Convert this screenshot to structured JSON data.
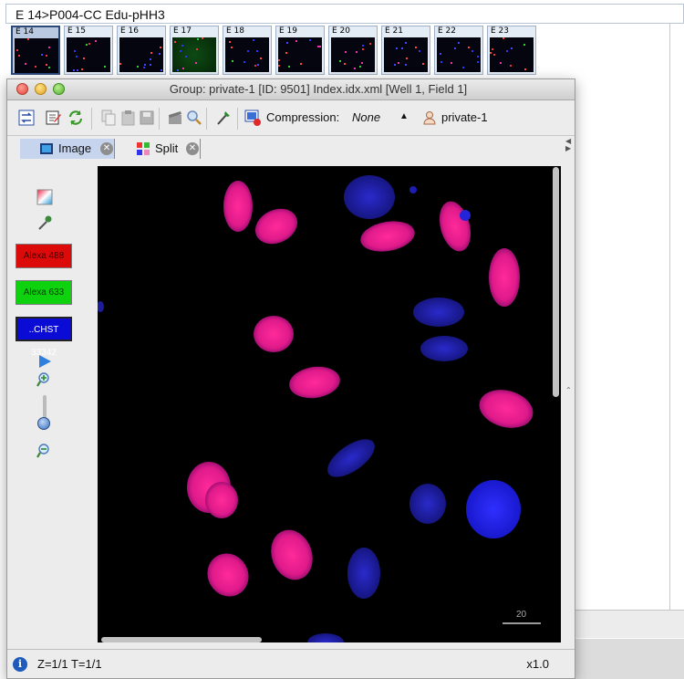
{
  "background_window": {
    "title": "E 14>P004-CC Edu-pHH3",
    "thumbnails": [
      {
        "label": "E 14",
        "selected": true
      },
      {
        "label": "E 15",
        "selected": false
      },
      {
        "label": "E 16",
        "selected": false
      },
      {
        "label": "E 17",
        "selected": false
      },
      {
        "label": "E 18",
        "selected": false
      },
      {
        "label": "E 19",
        "selected": false
      },
      {
        "label": "E 20",
        "selected": false
      },
      {
        "label": "E 21",
        "selected": false
      },
      {
        "label": "E 22",
        "selected": false
      },
      {
        "label": "E 23",
        "selected": false
      }
    ]
  },
  "window": {
    "title": "Group: private-1 [ID: 9501] Index.idx.xml [Well 1, Field 1]"
  },
  "toolbar": {
    "compression_label": "Compression:",
    "compression_value": "None",
    "group_name": "private-1"
  },
  "tabs": [
    {
      "label": "Image",
      "active": true,
      "icon": "image-viewer-icon"
    },
    {
      "label": "Split",
      "active": false,
      "icon": "split-view-icon"
    }
  ],
  "channels": [
    {
      "label": "Alexa 488",
      "color": "#dd0a0a"
    },
    {
      "label": "Alexa 633",
      "color": "#0ed20e"
    },
    {
      "label": "..CHST 33342",
      "color": "#0b0bd6"
    }
  ],
  "image": {
    "scale_bar_label": "20"
  },
  "status": {
    "zt_label": "Z=1/1 T=1/1",
    "zoom": "x1.0"
  }
}
